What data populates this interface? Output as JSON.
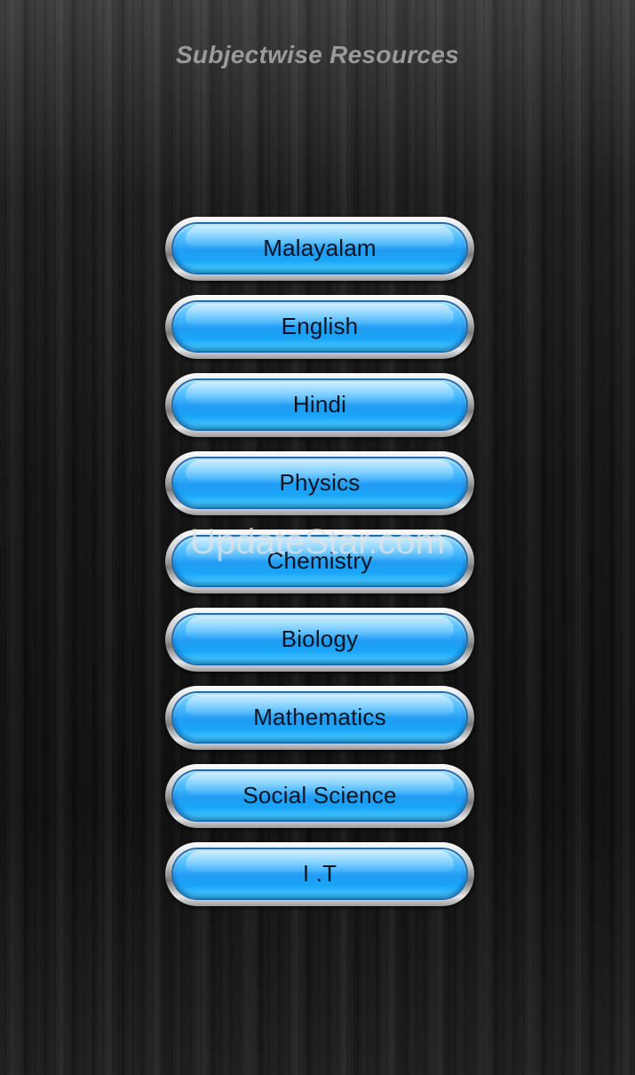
{
  "header": {
    "title": "Subjectwise Resources"
  },
  "subjects": [
    {
      "label": "Malayalam"
    },
    {
      "label": "English"
    },
    {
      "label": "Hindi"
    },
    {
      "label": "Physics"
    },
    {
      "label": "Chemistry"
    },
    {
      "label": "Biology"
    },
    {
      "label": "Mathematics"
    },
    {
      "label": "Social Science"
    },
    {
      "label": "I .T"
    }
  ],
  "watermark": {
    "text": "UpdateStar.com"
  },
  "colors": {
    "button_blue": "#1f9cf2",
    "button_highlight": "#8fd8ff",
    "title_gray": "#9a9a9a",
    "background": "#0d0d0d"
  }
}
